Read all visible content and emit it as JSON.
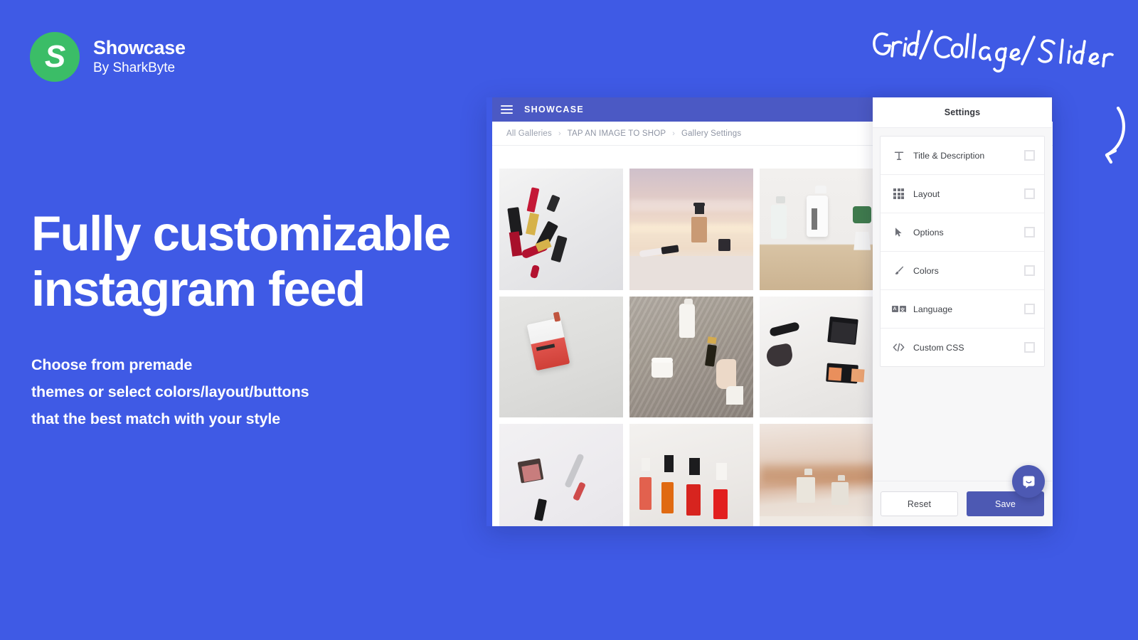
{
  "theme": {
    "background": "#3f5ae5",
    "brand_green": "#3bbd67",
    "appbar": "#4b59c4",
    "save_button": "#4d59b3",
    "panel_bg": "#f7f7f8"
  },
  "brand": {
    "logo_letter": "S",
    "name": "Showcase",
    "byline": "By SharkByte"
  },
  "hero": {
    "title": "Fully customizable\ninstagram feed",
    "subtitle": "Choose from premade\nthemes or select colors/layout/buttons\nthat the best match with your style"
  },
  "annotation": {
    "text": "Grid/Collage/Slider"
  },
  "mock": {
    "appbar": {
      "menu_icon": "hamburger-icon",
      "title": "SHOWCASE"
    },
    "breadcrumb": {
      "items": [
        "All Galleries",
        "TAP AN IMAGE TO SHOP",
        "Gallery Settings"
      ],
      "separator": "›"
    },
    "gallery": {
      "tiles": [
        {
          "name": "red-lipsticks",
          "alt": "Red lipsticks and nail polish on white"
        },
        {
          "name": "foundation-sunset",
          "alt": "Foundation bottle against pastel sunset"
        },
        {
          "name": "cocooil-bottle",
          "alt": "White COCOOIL body oil bottle with plant"
        },
        {
          "name": "red-pouch-packaging",
          "alt": "Red and white POUCH mockup packaging"
        },
        {
          "name": "skincare-set",
          "alt": "Skincare jar and bottle with hand holding serum"
        },
        {
          "name": "brush-palette",
          "alt": "Makeup brush and blush palette on white sheet"
        },
        {
          "name": "blush-flatlay",
          "alt": "Blush compact, lipstick and mascara flatlay"
        },
        {
          "name": "nail-polish-bottles",
          "alt": "Red and orange nail polish bottles"
        },
        {
          "name": "cream-bottles",
          "alt": "Two cream bottles on warm background"
        }
      ]
    }
  },
  "settings": {
    "title": "Settings",
    "items": [
      {
        "label": "Title & Description",
        "icon": "text-format-icon"
      },
      {
        "label": "Layout",
        "icon": "grid-icon"
      },
      {
        "label": "Options",
        "icon": "cursor-arrow-icon"
      },
      {
        "label": "Colors",
        "icon": "paintbrush-icon"
      },
      {
        "label": "Language",
        "icon": "language-icon"
      },
      {
        "label": "Custom CSS",
        "icon": "code-icon"
      }
    ],
    "reset_label": "Reset",
    "save_label": "Save",
    "chat_icon": "chat-bubble-icon"
  }
}
